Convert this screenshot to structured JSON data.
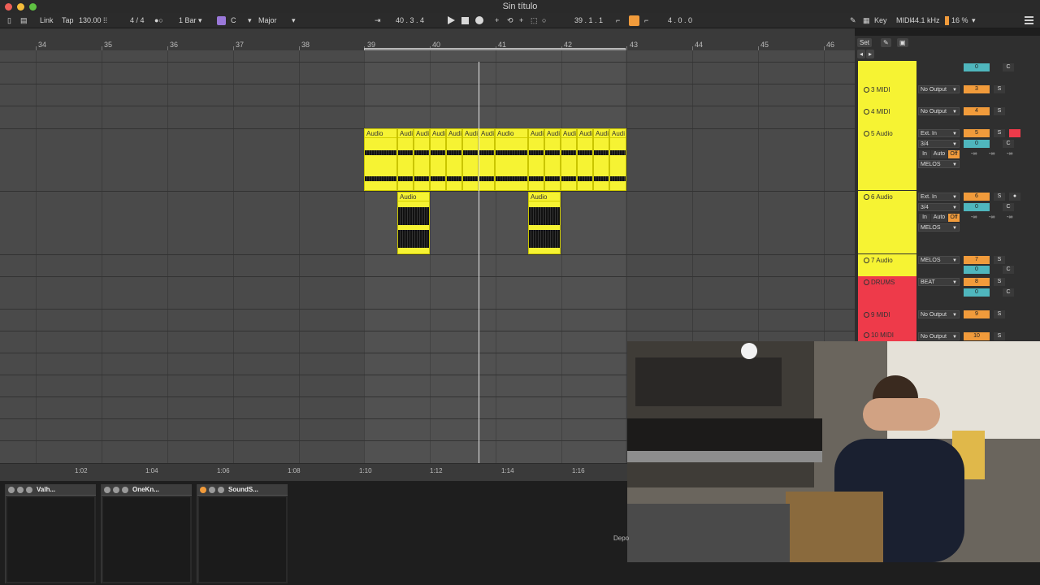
{
  "window": {
    "title": "Sin título"
  },
  "controlbar": {
    "link": "Link",
    "tap": "Tap",
    "tempo": "130.00",
    "time_sig": "4 / 4",
    "quantize": "1 Bar",
    "root_key": "C",
    "scale": "Major",
    "position": "40 .   3 .   4",
    "loop_start": "39 .   1 .   1",
    "loop_length": "4 .   0 .   0",
    "key": "Key",
    "midi": "MIDI",
    "sample_rate": "44.1 kHz",
    "cpu": "16 %"
  },
  "ruler": {
    "bars": [
      "34",
      "35",
      "36",
      "37",
      "38",
      "39",
      "40",
      "41",
      "42",
      "43",
      "44",
      "45",
      "46"
    ]
  },
  "arrangement": {
    "track5_clips": [
      "Audio",
      "Audi",
      "Audi",
      "Audi",
      "Audi",
      "Audi",
      "Audi",
      "Audio",
      "Audi",
      "Audi",
      "Audi",
      "Audi",
      "Audi",
      "Audi"
    ],
    "track6_clips": [
      "Audio",
      "Audio"
    ]
  },
  "bottom_timeline": {
    "labels": [
      "1:02",
      "1:04",
      "1:06",
      "1:08",
      "1:10",
      "1:12",
      "1:14",
      "1:16"
    ]
  },
  "mixer": {
    "set": "Set",
    "tracks": [
      {
        "name": "3 MIDI",
        "color": "#f6f333",
        "output": "No Output",
        "number": "3",
        "solo": "S"
      },
      {
        "name": "4 MIDI",
        "color": "#f6f333",
        "output": "No Output",
        "number": "4",
        "solo": "S"
      },
      {
        "name": "5 Audio",
        "color": "#f6f333",
        "input": "Ext. In",
        "channel": "3/4",
        "monitor_in": "In",
        "monitor_auto": "Auto",
        "monitor_off": "Off",
        "output": "MELOS",
        "number": "5",
        "send": "0",
        "pan": "C",
        "solo": "S"
      },
      {
        "name": "6 Audio",
        "color": "#f6f333",
        "input": "Ext. In",
        "channel": "3/4",
        "monitor_in": "In",
        "monitor_auto": "Auto",
        "monitor_off": "Off",
        "output": "MELOS",
        "number": "6",
        "send": "0",
        "pan": "C",
        "solo": "S"
      },
      {
        "name": "7 Audio",
        "color": "#f6f333",
        "output": "MELOS",
        "number": "7",
        "send": "0",
        "pan": "C",
        "solo": "S"
      },
      {
        "name": "DRUMS",
        "color": "#ee3a4a",
        "output": "BEAT",
        "number": "8",
        "send": "0",
        "pan": "C",
        "solo": "S"
      },
      {
        "name": "9 MIDI",
        "color": "#ee3a4a",
        "output": "No Output",
        "number": "9",
        "solo": "S"
      },
      {
        "name": "10 MIDI",
        "color": "#ee3a4a",
        "output": "No Output",
        "number": "10",
        "solo": "S"
      }
    ],
    "top_send": "0",
    "top_pan": "C",
    "db": "-∞"
  },
  "devices": [
    {
      "name": "Valh..."
    },
    {
      "name": "OneKn..."
    },
    {
      "name": "SoundS..."
    }
  ],
  "webcam": {
    "caption": "Depo"
  }
}
